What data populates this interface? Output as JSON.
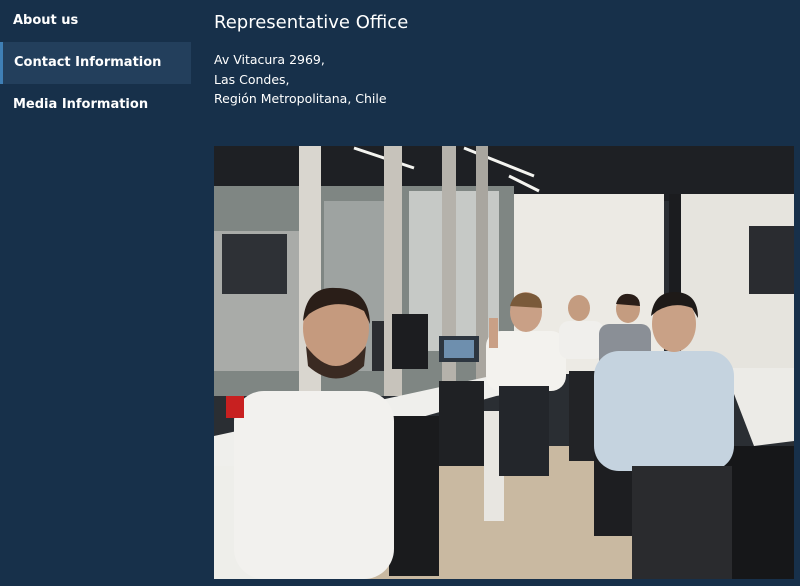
{
  "sidebar": {
    "items": [
      {
        "label": "About us",
        "active": false
      },
      {
        "label": "Contact Information",
        "active": true
      },
      {
        "label": "Media Information",
        "active": false
      }
    ]
  },
  "main": {
    "title": "Representative Office",
    "address_lines": [
      "Av Vitacura 2969,",
      "Las Condes,",
      "Región Metropolitana, Chile"
    ]
  },
  "photo": {
    "icon": "office-team-photo"
  },
  "colors": {
    "background": "#17304a",
    "active_item_bg": "#233f5c",
    "active_item_border": "#3f7fb5",
    "text": "#ffffff"
  }
}
